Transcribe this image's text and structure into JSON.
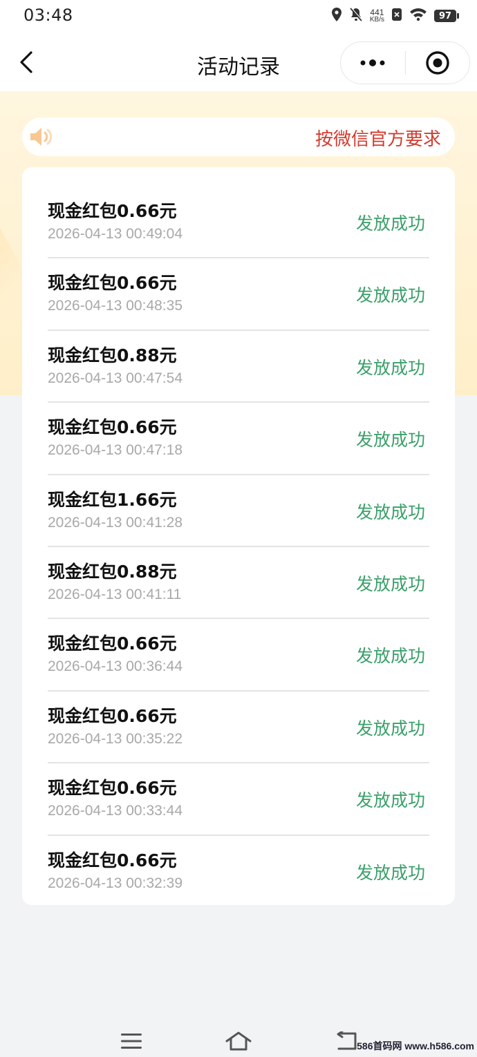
{
  "status_bar": {
    "time": "03:48",
    "net_speed_value": "441",
    "net_speed_unit": "KB/s",
    "battery": "97",
    "icons": [
      "location-icon",
      "mute-icon",
      "sim-icon",
      "wifi-icon",
      "battery-icon"
    ]
  },
  "nav": {
    "title": "活动记录",
    "icons": [
      "back-icon",
      "more-dots-icon",
      "close-target-icon"
    ]
  },
  "notice": {
    "text": "按微信官方要求",
    "icon": "speaker-icon"
  },
  "records": [
    {
      "title": "现金红包0.66元",
      "time": "2026-04-13 00:49:04",
      "status": "发放成功"
    },
    {
      "title": "现金红包0.66元",
      "time": "2026-04-13 00:48:35",
      "status": "发放成功"
    },
    {
      "title": "现金红包0.88元",
      "time": "2026-04-13 00:47:54",
      "status": "发放成功"
    },
    {
      "title": "现金红包0.66元",
      "time": "2026-04-13 00:47:18",
      "status": "发放成功"
    },
    {
      "title": "现金红包1.66元",
      "time": "2026-04-13 00:41:28",
      "status": "发放成功"
    },
    {
      "title": "现金红包0.88元",
      "time": "2026-04-13 00:41:11",
      "status": "发放成功"
    },
    {
      "title": "现金红包0.66元",
      "time": "2026-04-13 00:36:44",
      "status": "发放成功"
    },
    {
      "title": "现金红包0.66元",
      "time": "2026-04-13 00:35:22",
      "status": "发放成功"
    },
    {
      "title": "现金红包0.66元",
      "time": "2026-04-13 00:33:44",
      "status": "发放成功"
    },
    {
      "title": "现金红包0.66元",
      "time": "2026-04-13 00:32:39",
      "status": "发放成功"
    }
  ],
  "watermark": "586首码网 www.h586.com",
  "colors": {
    "status_success": "#3aa06a",
    "notice_text": "#d33b2e",
    "time_text": "#a8a8a8",
    "banner_bg": "#ffefc9"
  }
}
